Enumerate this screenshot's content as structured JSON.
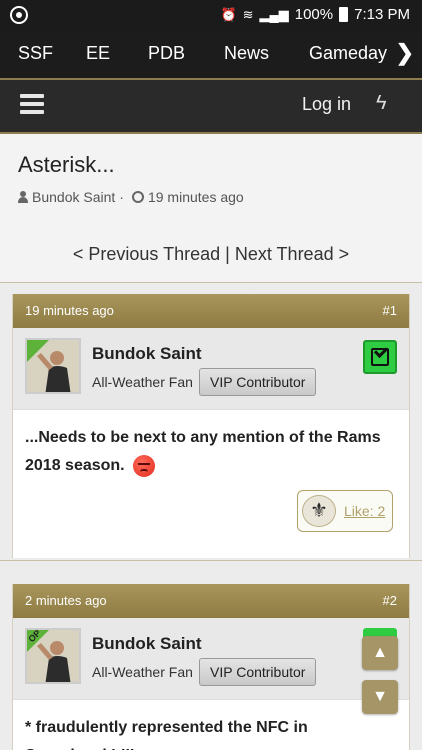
{
  "status_bar": {
    "battery": "100%",
    "time": "7:13 PM"
  },
  "top_nav": {
    "items": [
      "SSF",
      "EE",
      "PDB",
      "News",
      "Gameday"
    ],
    "more_icon": "chevron-right-icon"
  },
  "sub_bar": {
    "login_label": "Log in",
    "menu_icon": "hamburger-icon",
    "activity_icon": "bolt-icon"
  },
  "thread": {
    "title": "Asterisk...",
    "author": "Bundok Saint",
    "separator": "·",
    "age": "19 minutes ago",
    "prev_label": "< Previous Thread",
    "divider": "|",
    "next_label": "Next Thread >"
  },
  "posts": [
    {
      "time": "19 minutes ago",
      "number": "#1",
      "username": "Bundok Saint",
      "rank": "All-Weather Fan",
      "badge": "VIP Contributor",
      "body": "...Needs to be next to any mention of the Rams 2018 season.",
      "emoji": "angry-face-icon",
      "like_label": "Like: 2"
    },
    {
      "time": "2 minutes ago",
      "number": "#2",
      "op_label": "OP",
      "username": "Bundok Saint",
      "rank": "All-Weather Fan",
      "badge": "VIP Contributor",
      "body": "* fraudulently represented the NFC in Superbowl LIII"
    }
  ],
  "colors": {
    "gold": "#a69566",
    "dark_bar": "#1c1c1c",
    "check_green": "#2ecc40"
  }
}
